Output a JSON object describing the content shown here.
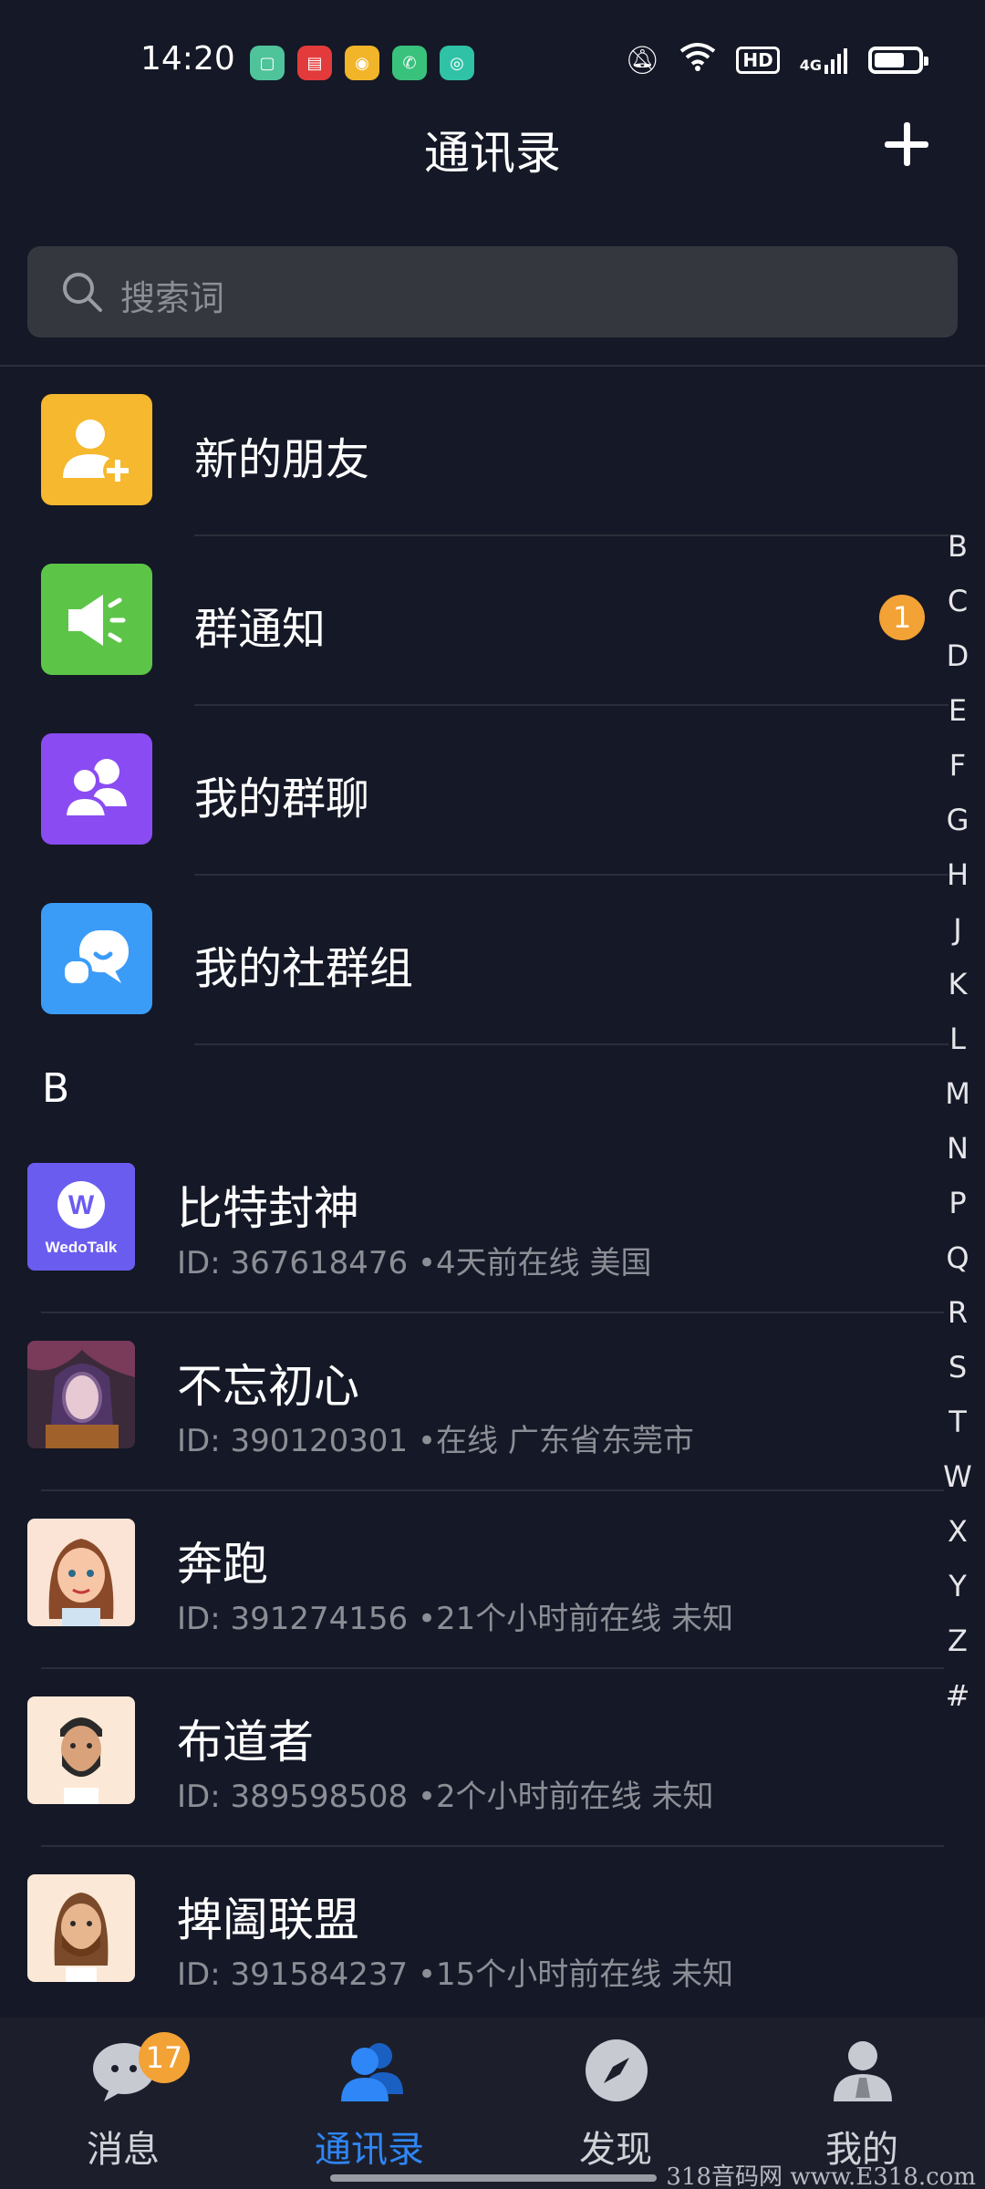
{
  "status_bar": {
    "time": "14:20",
    "network": "4G",
    "hd_label": "HD",
    "app_icons": [
      "messages-app-icon",
      "news-app-icon",
      "weibo-app-icon",
      "phone-app-icon",
      "chat-app-icon"
    ]
  },
  "header": {
    "title": "通讯录"
  },
  "search": {
    "placeholder": "搜索词"
  },
  "features": [
    {
      "label": "新的朋友",
      "icon": "add-friend-icon",
      "color": "#f5b82e"
    },
    {
      "label": "群通知",
      "icon": "megaphone-icon",
      "color": "#5cc548",
      "badge": "1"
    },
    {
      "label": "我的群聊",
      "icon": "group-chat-icon",
      "color": "#8a4cf2"
    },
    {
      "label": "我的社群组",
      "icon": "community-icon",
      "color": "#3b9cf8"
    }
  ],
  "section_letter": "B",
  "contacts": [
    {
      "name": "比特封神",
      "meta": "ID: 367618476 •4天前在线  美国",
      "avatar": "wedotalk-logo",
      "logo_text": "WedoTalk"
    },
    {
      "name": "不忘初心",
      "meta": "ID: 390120301 •在线  广东省东莞市",
      "avatar": "fantasy-portrait"
    },
    {
      "name": "奔跑",
      "meta": "ID: 391274156 •21个小时前在线  未知",
      "avatar": "woman-cartoon"
    },
    {
      "name": "布道者",
      "meta": "ID: 389598508 •2个小时前在线  未知",
      "avatar": "bearded-man-cartoon"
    },
    {
      "name": "捭阖联盟",
      "meta": "ID: 391584237 •15个小时前在线  未知",
      "avatar": "long-hair-man-cartoon"
    }
  ],
  "alpha_index": [
    "B",
    "C",
    "D",
    "E",
    "F",
    "G",
    "H",
    "J",
    "K",
    "L",
    "M",
    "N",
    "P",
    "Q",
    "R",
    "S",
    "T",
    "W",
    "X",
    "Y",
    "Z",
    "#"
  ],
  "bottom_nav": [
    {
      "label": "消息",
      "icon": "chat-bubble-icon",
      "badge": "17"
    },
    {
      "label": "通讯录",
      "icon": "contacts-icon",
      "active": true
    },
    {
      "label": "发现",
      "icon": "compass-icon"
    },
    {
      "label": "我的",
      "icon": "profile-icon"
    }
  ],
  "watermark": "318音码网 www.E318.com",
  "colors": {
    "background": "#151826",
    "accent": "#2f86f6",
    "badge": "#f3a236"
  }
}
